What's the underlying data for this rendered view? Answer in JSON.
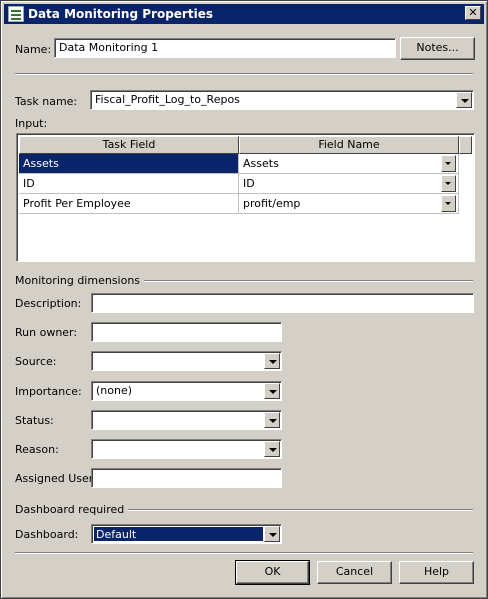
{
  "window": {
    "title": "Data Monitoring Properties",
    "close_glyph": "✕"
  },
  "name": {
    "label": "Name:",
    "value": "Data Monitoring 1",
    "notes_button": "Notes..."
  },
  "task": {
    "label": "Task name:",
    "value": "Fiscal_Profit_Log_to_Repos"
  },
  "input": {
    "label": "Input:",
    "columns": [
      "Task Field",
      "Field Name"
    ],
    "rows": [
      {
        "task_field": "Assets",
        "field_name": "Assets"
      },
      {
        "task_field": "ID",
        "field_name": "ID"
      },
      {
        "task_field": "Profit Per Employee",
        "field_name": "profit/emp"
      }
    ]
  },
  "monitoring": {
    "section_label": "Monitoring dimensions",
    "description_label": "Description:",
    "description_value": "",
    "run_owner_label": "Run owner:",
    "run_owner_value": "",
    "source_label": "Source:",
    "source_value": "",
    "importance_label": "Importance:",
    "importance_value": "(none)",
    "status_label": "Status:",
    "status_value": "",
    "reason_label": "Reason:",
    "reason_value": "",
    "assigned_user_label": "Assigned User:",
    "assigned_user_value": ""
  },
  "dashboard": {
    "section_label": "Dashboard required",
    "label": "Dashboard:",
    "value": "Default"
  },
  "buttons": {
    "ok": "OK",
    "cancel": "Cancel",
    "help": "Help"
  }
}
